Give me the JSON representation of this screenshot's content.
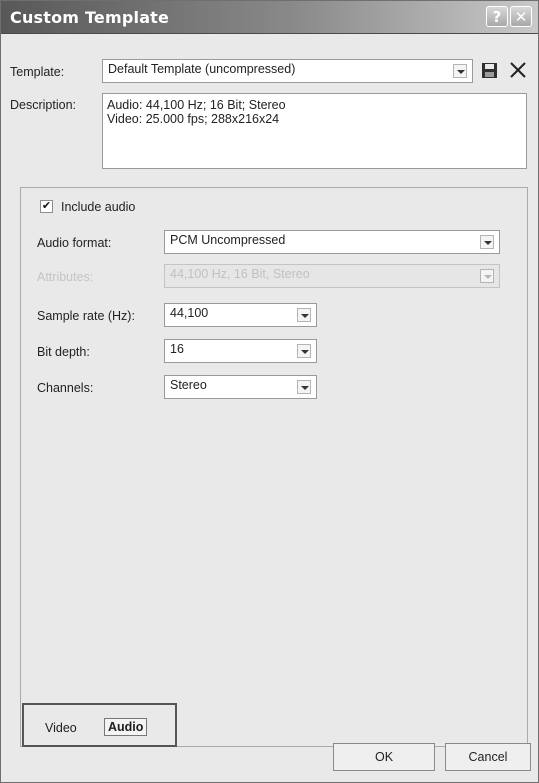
{
  "window": {
    "title": "Custom Template",
    "help_label": "?",
    "close_label": "✕"
  },
  "template": {
    "label": "Template:",
    "value": "Default Template (uncompressed)"
  },
  "description": {
    "label": "Description:",
    "line1": "Audio: 44,100 Hz; 16 Bit; Stereo",
    "line2": "Video: 25.000 fps; 288x216x24"
  },
  "audio": {
    "include_label": "Include audio",
    "include_checked": true,
    "audio_format_label": "Audio format:",
    "audio_format_value": "PCM Uncompressed",
    "attributes_label": "Attributes:",
    "attributes_value": "44,100 Hz, 16 Bit, Stereo",
    "sample_rate_label": "Sample rate (Hz):",
    "sample_rate_value": "44,100",
    "bit_depth_label": "Bit depth:",
    "bit_depth_value": "16",
    "channels_label": "Channels:",
    "channels_value": "Stereo"
  },
  "tabs": [
    {
      "label": "Video",
      "active": false
    },
    {
      "label": "Audio",
      "active": true
    }
  ],
  "buttons": {
    "ok": "OK",
    "cancel": "Cancel"
  },
  "icons": {
    "save": "floppy-disk-icon",
    "delete": "x-delete-icon"
  }
}
